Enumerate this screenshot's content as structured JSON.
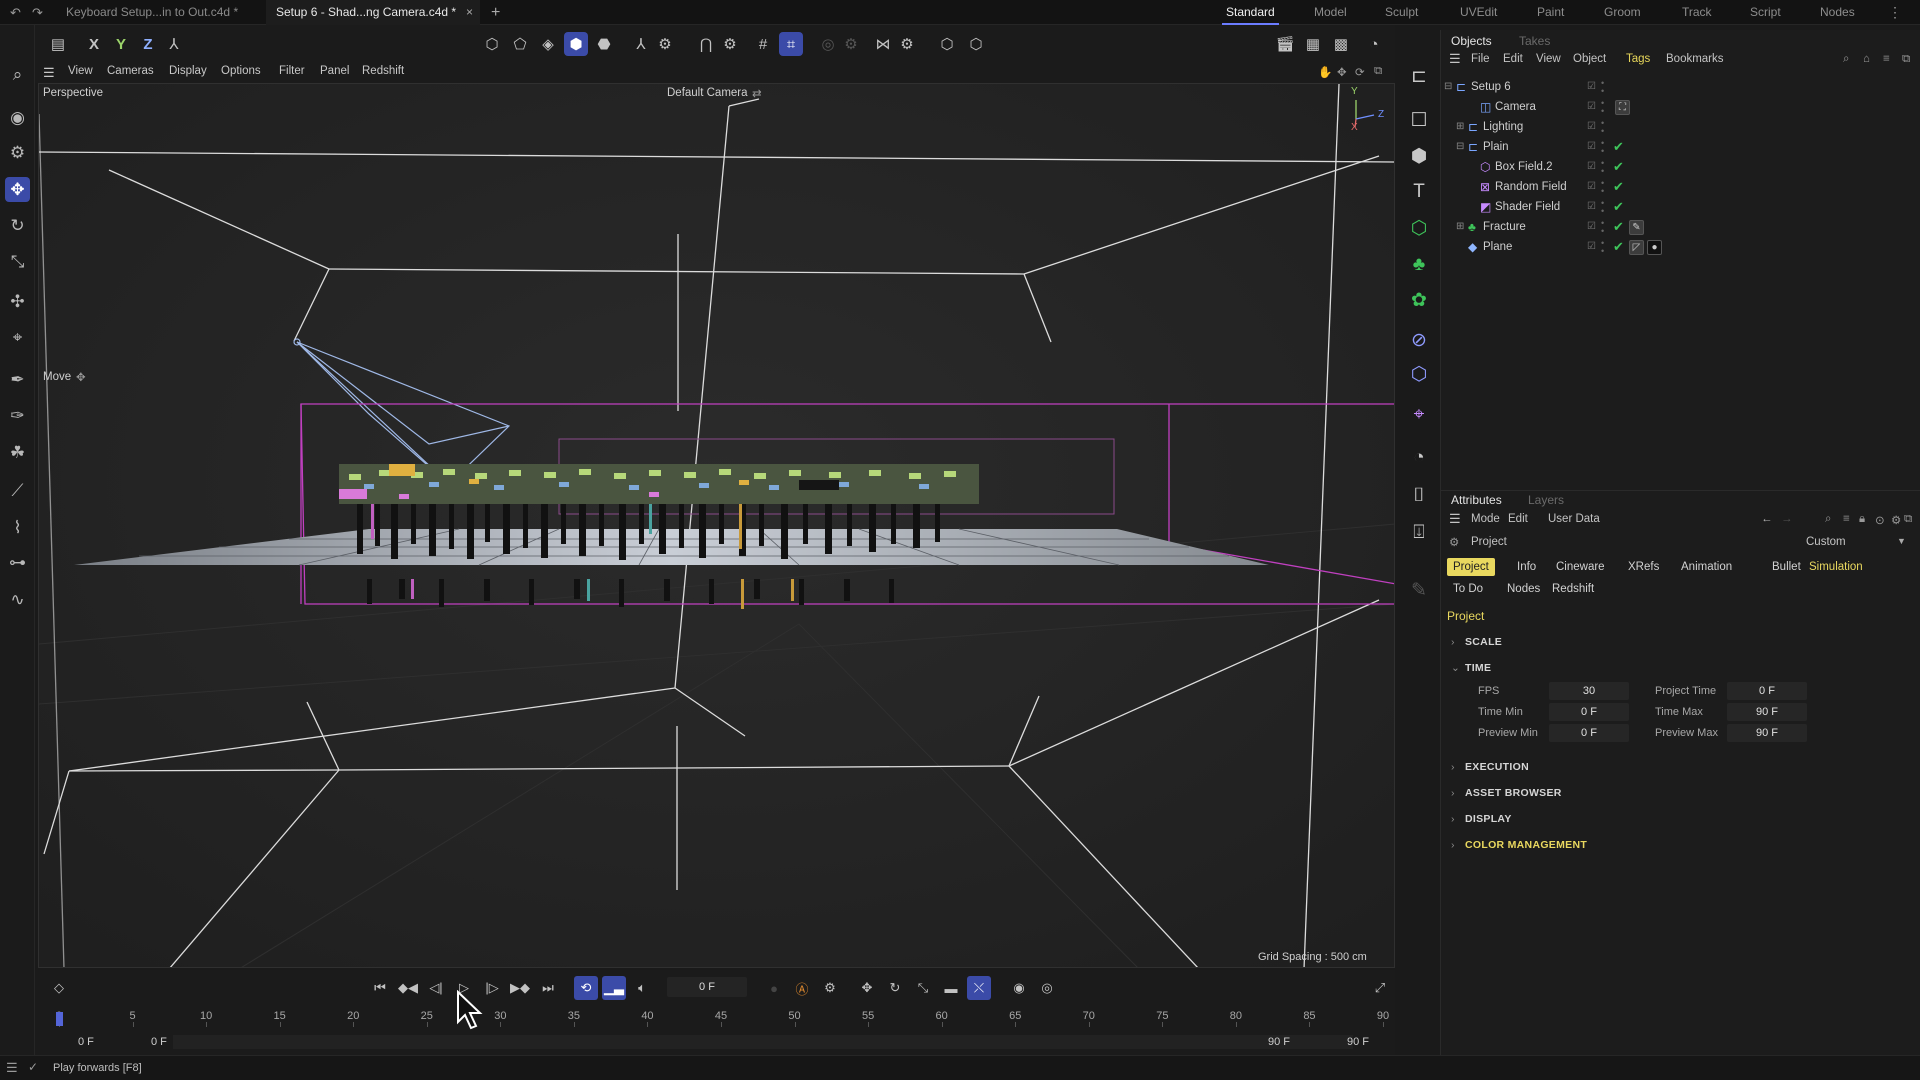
{
  "topbar": {
    "file_tabs": [
      "Keyboard Setup...in to Out.c4d *",
      "Setup 6 - Shad...ng Camera.c4d *"
    ],
    "close_glyph": "×",
    "add_glyph": "+",
    "layouts": [
      "Standard",
      "Model",
      "Sculpt",
      "UVEdit",
      "Paint",
      "Groom",
      "Track",
      "Script",
      "Nodes"
    ],
    "active_layout": "Standard"
  },
  "main_toolbar": {
    "axis_x": "X",
    "axis_y": "Y",
    "axis_z": "Z"
  },
  "viewport_menu": [
    "View",
    "Cameras",
    "Display",
    "Options",
    "Filter",
    "Panel",
    "Redshift"
  ],
  "viewport": {
    "projection": "Perspective",
    "camera": "Default Camera",
    "camera_glyph": "⇄",
    "tool_label": "Move",
    "tool_glyph": "✥",
    "grid_spacing": "Grid Spacing : 500 cm",
    "axis_y": "Y",
    "axis_x": "X",
    "axis_z": "Z"
  },
  "objects_panel": {
    "tabs": [
      "Objects",
      "Takes"
    ],
    "active_tab": "Objects",
    "menu": [
      "File",
      "Edit",
      "View",
      "Object",
      "Tags",
      "Bookmarks"
    ],
    "highlight_menu": "Tags",
    "check_glyph": "✔",
    "tree": [
      {
        "name": "Setup 6",
        "expand": "⊟",
        "icon": "null",
        "glyph": "⊏",
        "color": "#7aa6ff"
      },
      {
        "name": "Camera",
        "expand": "",
        "icon": "camera",
        "glyph": "◫",
        "color": "#7aa6ff",
        "tag": "⛶"
      },
      {
        "name": "Lighting",
        "expand": "⊞",
        "icon": "null",
        "glyph": "⊏",
        "color": "#7aa6ff"
      },
      {
        "name": "Plain",
        "expand": "⊟",
        "icon": "effector",
        "glyph": "⊏",
        "color": "#7aa6ff",
        "check": true
      },
      {
        "name": "Box Field.2",
        "expand": "",
        "icon": "field",
        "glyph": "⬡",
        "color": "#c78bff",
        "check": true
      },
      {
        "name": "Random Field",
        "expand": "",
        "icon": "field",
        "glyph": "⊠",
        "color": "#c78bff",
        "check": true
      },
      {
        "name": "Shader Field",
        "expand": "",
        "icon": "field",
        "glyph": "◩",
        "color": "#c78bff",
        "check": true
      },
      {
        "name": "Fracture",
        "expand": "⊞",
        "icon": "mograph",
        "glyph": "♣",
        "color": "#3ec45a",
        "check": true,
        "tag": "✎"
      },
      {
        "name": "Plane",
        "expand": "",
        "icon": "plane",
        "glyph": "◆",
        "color": "#8fb6ff",
        "check": true,
        "tag": "◸",
        "tag2": "●"
      }
    ]
  },
  "attributes_panel": {
    "tabs": [
      "Attributes",
      "Layers"
    ],
    "active_tab": "Attributes",
    "menu": [
      "Mode",
      "Edit",
      "User Data"
    ],
    "subject": "Project",
    "preset": "Custom",
    "tab_row1": [
      "Project",
      "Info",
      "Cineware",
      "XRefs",
      "Animation",
      "Bullet",
      "Simulation"
    ],
    "tab_row2": [
      "To Do",
      "Nodes",
      "Redshift"
    ],
    "active_tab_btn": "Project",
    "highlight_tab_btn": "Simulation",
    "section_title": "Project",
    "sections": {
      "scale": "SCALE",
      "time": "TIME",
      "execution": "EXECUTION",
      "asset_browser": "ASSET BROWSER",
      "display": "DISPLAY",
      "color_management": "COLOR MANAGEMENT"
    },
    "time_fields": {
      "fps_label": "FPS",
      "fps": "30",
      "project_time_label": "Project Time",
      "project_time": "0 F",
      "time_min_label": "Time Min",
      "time_min": "0 F",
      "time_max_label": "Time Max",
      "time_max": "90 F",
      "preview_min_label": "Preview Min",
      "preview_min": "0 F",
      "preview_max_label": "Preview Max",
      "preview_max": "90 F"
    }
  },
  "timeline": {
    "current_frame": "0 F",
    "ruler": [
      "0",
      "5",
      "10",
      "15",
      "20",
      "25",
      "30",
      "35",
      "40",
      "45",
      "50",
      "55",
      "60",
      "65",
      "70",
      "75",
      "80",
      "85",
      "90"
    ],
    "range_start_a": "0 F",
    "range_start_b": "0 F",
    "range_end_a": "90 F",
    "range_end_b": "90 F"
  },
  "status": {
    "text": "Play forwards [F8]"
  },
  "colors": {
    "accent_blue": "#3b4ba8",
    "highlight_yellow": "#e9d85f",
    "check_green": "#3ec45a",
    "bbox_magenta": "#c040c0"
  }
}
